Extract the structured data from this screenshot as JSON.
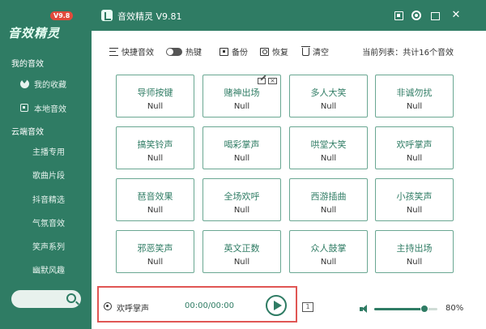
{
  "app": {
    "title": "音效精灵 V9.81",
    "logo_text": "音效精灵",
    "logo_badge": "V9.8"
  },
  "sidebar": {
    "my_section": "我的音效",
    "my_items": [
      {
        "label": "我的收藏",
        "icon": "favorite-icon"
      },
      {
        "label": "本地音效",
        "icon": "local-icon"
      }
    ],
    "cloud_section": "云端音效",
    "cloud_items": [
      "主播专用",
      "歌曲片段",
      "抖音精选",
      "气氛音效",
      "笑声系列",
      "幽默风趣"
    ],
    "search": {
      "placeholder": ""
    }
  },
  "toolbar": {
    "quick_label": "快捷音效",
    "hotkey_label": "热键",
    "backup_label": "备份",
    "restore_label": "恢复",
    "clear_label": "清空",
    "list_info": "当前列表：共计16个音效"
  },
  "cards": [
    {
      "name": "导师按键",
      "key": "Null"
    },
    {
      "name": "赌神出场",
      "key": "Null"
    },
    {
      "name": "多人大笑",
      "key": "Null"
    },
    {
      "name": "非诚勿扰",
      "key": "Null"
    },
    {
      "name": "搞笑铃声",
      "key": "Null"
    },
    {
      "name": "喝彩掌声",
      "key": "Null"
    },
    {
      "name": "哄堂大笑",
      "key": "Null"
    },
    {
      "name": "欢呼掌声",
      "key": "Null"
    },
    {
      "name": "琶音效果",
      "key": "Null"
    },
    {
      "name": "全场欢呼",
      "key": "Null"
    },
    {
      "name": "西游插曲",
      "key": "Null"
    },
    {
      "name": "小孩笑声",
      "key": "Null"
    },
    {
      "name": "邪恶笑声",
      "key": "Null"
    },
    {
      "name": "英文正数",
      "key": "Null"
    },
    {
      "name": "众人鼓掌",
      "key": "Null"
    },
    {
      "name": "主持出场",
      "key": "Null"
    }
  ],
  "player": {
    "track": "欢呼掌声",
    "time": "00:00/00:00",
    "volume": 0.8,
    "volume_label": "80%",
    "repeat_label": "1"
  },
  "colors": {
    "primary": "#2f7c64",
    "card_border": "#6aa792",
    "highlight": "#e05654"
  }
}
